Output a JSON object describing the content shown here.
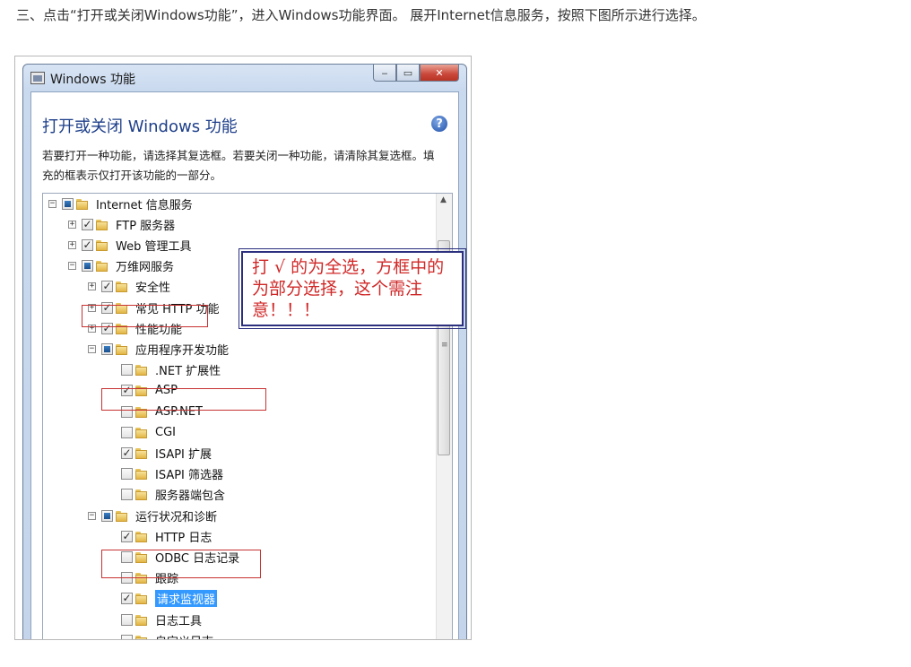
{
  "instruction": "三、点击“打开或关闭Windows功能”，进入Windows功能界面。 展开Internet信息服务，按照下图所示进行选择。",
  "window": {
    "title": "Windows 功能",
    "buttons": {
      "minimize": "‒",
      "maximize": "▭",
      "close": "✕"
    },
    "heading": "打开或关闭 Windows 功能",
    "help": "?",
    "description": "若要打开一种功能，请选择其复选框。若要关闭一种功能，请清除其复选框。填充的框表示仅打开该功能的一部分。"
  },
  "callout": "打 √ 的为全选，方框中的为部分选择，这个需注意！！！",
  "tree": [
    {
      "label": "Internet 信息服务",
      "level": 0,
      "expander": "minus",
      "state": "partial"
    },
    {
      "label": "FTP 服务器",
      "level": 1,
      "expander": "plus",
      "state": "checked"
    },
    {
      "label": "Web 管理工具",
      "level": 1,
      "expander": "plus",
      "state": "checked"
    },
    {
      "label": "万维网服务",
      "level": 1,
      "expander": "minus",
      "state": "partial"
    },
    {
      "label": "安全性",
      "level": 2,
      "expander": "plus",
      "state": "checked"
    },
    {
      "label": "常见 HTTP 功能",
      "level": 2,
      "expander": "plus",
      "state": "checked"
    },
    {
      "label": "性能功能",
      "level": 2,
      "expander": "plus",
      "state": "checked"
    },
    {
      "label": "应用程序开发功能",
      "level": 2,
      "expander": "minus",
      "state": "partial"
    },
    {
      "label": ".NET 扩展性",
      "level": 3,
      "expander": "none",
      "state": "unchecked"
    },
    {
      "label": "ASP",
      "level": 3,
      "expander": "none",
      "state": "checked"
    },
    {
      "label": "ASP.NET",
      "level": 3,
      "expander": "none",
      "state": "unchecked"
    },
    {
      "label": "CGI",
      "level": 3,
      "expander": "none",
      "state": "unchecked"
    },
    {
      "label": "ISAPI 扩展",
      "level": 3,
      "expander": "none",
      "state": "checked"
    },
    {
      "label": "ISAPI 筛选器",
      "level": 3,
      "expander": "none",
      "state": "unchecked"
    },
    {
      "label": "服务器端包含",
      "level": 3,
      "expander": "none",
      "state": "unchecked"
    },
    {
      "label": "运行状况和诊断",
      "level": 2,
      "expander": "minus",
      "state": "partial"
    },
    {
      "label": "HTTP 日志",
      "level": 3,
      "expander": "none",
      "state": "checked"
    },
    {
      "label": "ODBC 日志记录",
      "level": 3,
      "expander": "none",
      "state": "unchecked"
    },
    {
      "label": "跟踪",
      "level": 3,
      "expander": "none",
      "state": "unchecked"
    },
    {
      "label": "请求监视器",
      "level": 3,
      "expander": "none",
      "state": "checked",
      "selected": true
    },
    {
      "label": "日志工具",
      "level": 3,
      "expander": "none",
      "state": "unchecked"
    },
    {
      "label": "自定义日志",
      "level": 3,
      "expander": "none",
      "state": "unchecked"
    }
  ]
}
